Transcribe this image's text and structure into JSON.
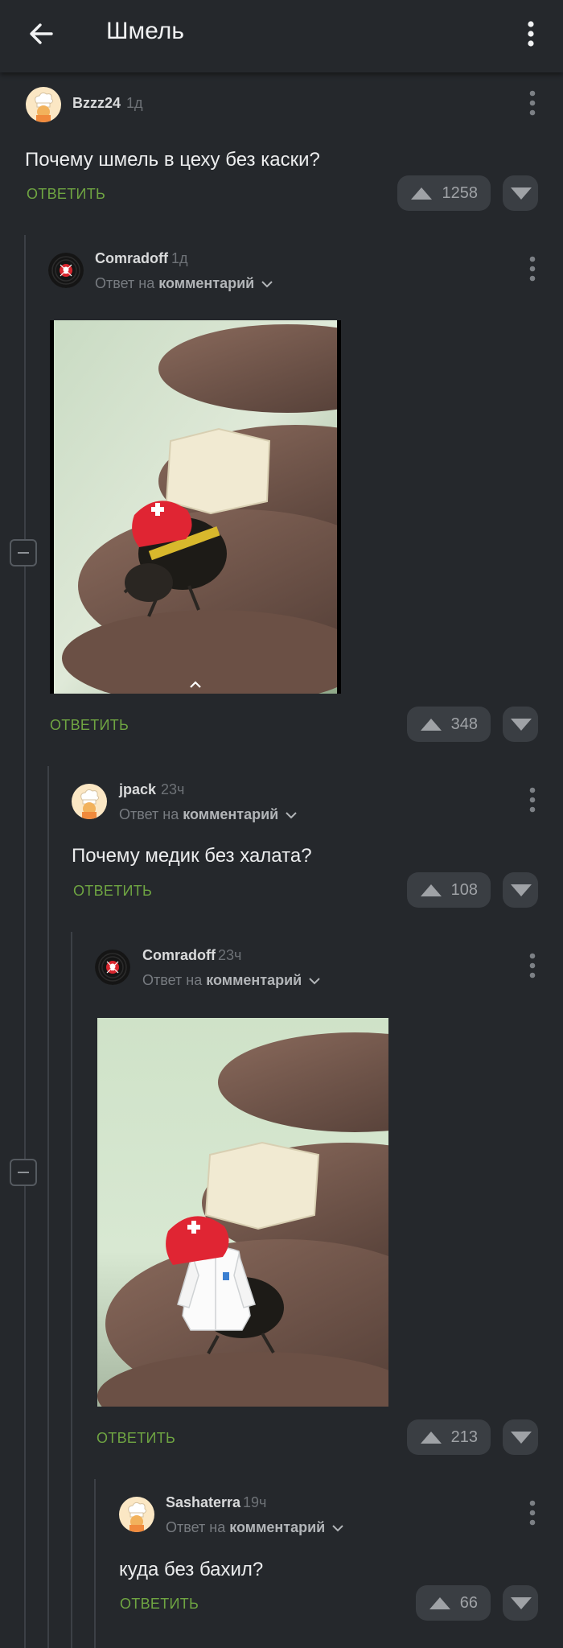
{
  "header": {
    "title": "Шмель",
    "back_icon": "arrow-left-icon",
    "menu_icon": "more-vertical-icon"
  },
  "colors": {
    "background": "#25282c",
    "accent_green": "#6fa542",
    "vote_button": "#3a3e43",
    "helmet_red": "#e02533"
  },
  "comments": [
    {
      "author": "Bzzz24",
      "time": "1д",
      "text": "Почему шмель в цеху без каски?",
      "reply_label": "ОТВЕТИТЬ",
      "votes": "1258",
      "avatar": "chef-avatar"
    },
    {
      "author": "Comradoff",
      "time": "1д",
      "reply_prefix": "Ответ на",
      "reply_target": "комментарий",
      "reply_label": "ОТВЕТИТЬ",
      "votes": "348",
      "avatar": "vinyl-skull-avatar",
      "image": "bumblebee-with-helmet-on-finger"
    },
    {
      "author": "jpack",
      "time": "23ч",
      "reply_prefix": "Ответ на",
      "reply_target": "комментарий",
      "text": "Почему медик без халата?",
      "reply_label": "ОТВЕТИТЬ",
      "votes": "108",
      "avatar": "chef-avatar"
    },
    {
      "author": "Comradoff",
      "time": "23ч",
      "reply_prefix": "Ответ на",
      "reply_target": "комментарий",
      "reply_label": "ОТВЕТИТЬ",
      "votes": "213",
      "avatar": "vinyl-skull-avatar",
      "image": "bumblebee-with-helmet-and-lab-coat"
    },
    {
      "author": "Sashaterra",
      "time": "19ч",
      "reply_prefix": "Ответ на",
      "reply_target": "комментарий",
      "text": "куда без бахил?",
      "reply_label": "ОТВЕТИТЬ",
      "votes": "66",
      "avatar": "chef-avatar"
    }
  ]
}
